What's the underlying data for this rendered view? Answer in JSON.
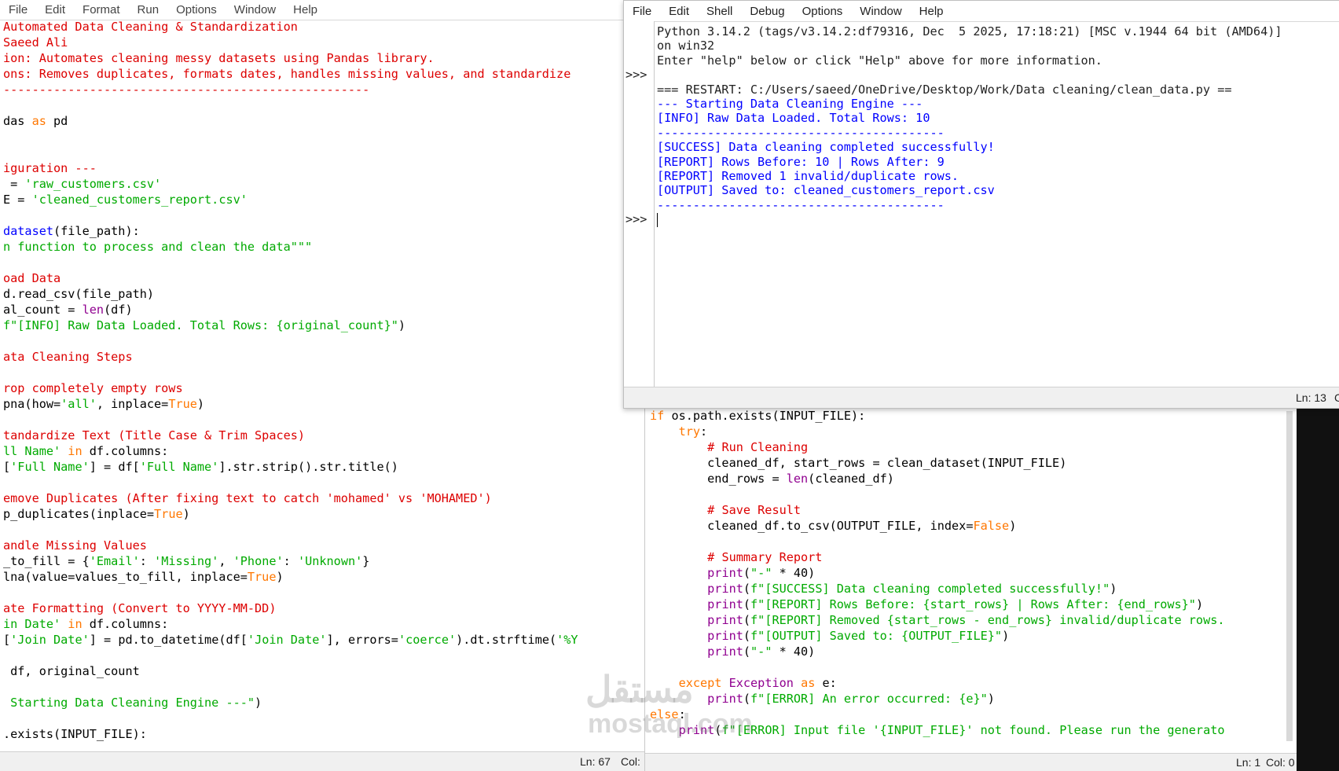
{
  "left_editor": {
    "menu": [
      "File",
      "Edit",
      "Format",
      "Run",
      "Options",
      "Window",
      "Help"
    ],
    "status": {
      "ln": "Ln: 67",
      "col": "Col:"
    },
    "lines": [
      [
        {
          "t": "Automated Data Cleaning & Standardization",
          "c": "c"
        }
      ],
      [
        {
          "t": "Saeed Ali",
          "c": "c"
        }
      ],
      [
        {
          "t": "ion: Automates cleaning messy datasets using Pandas library.",
          "c": "c"
        }
      ],
      [
        {
          "t": "ons: Removes duplicates, formats dates, handles missing values, and standardize",
          "c": "c"
        }
      ],
      [
        {
          "t": "---------------------------------------------------",
          "c": "c"
        }
      ],
      [],
      [
        {
          "t": "das ",
          "c": "n"
        },
        {
          "t": "as",
          "c": "k"
        },
        {
          "t": " pd",
          "c": "n"
        }
      ],
      [],
      [],
      [
        {
          "t": "iguration ---",
          "c": "c"
        }
      ],
      [
        {
          "t": " = ",
          "c": "n"
        },
        {
          "t": "'raw_customers.csv'",
          "c": "s"
        }
      ],
      [
        {
          "t": "E = ",
          "c": "n"
        },
        {
          "t": "'cleaned_customers_report.csv'",
          "c": "s"
        }
      ],
      [],
      [
        {
          "t": "dataset",
          "c": "d"
        },
        {
          "t": "(file_path):",
          "c": "n"
        }
      ],
      [
        {
          "t": "n function to process and clean the data\"\"\"",
          "c": "s"
        }
      ],
      [],
      [
        {
          "t": "oad Data",
          "c": "c"
        }
      ],
      [
        {
          "t": "d.read_csv(file_path)",
          "c": "n"
        }
      ],
      [
        {
          "t": "al_count = ",
          "c": "n"
        },
        {
          "t": "len",
          "c": "b"
        },
        {
          "t": "(df)",
          "c": "n"
        }
      ],
      [
        {
          "t": "f\"[INFO] Raw Data Loaded. Total Rows: {original_count}\"",
          "c": "s"
        },
        {
          "t": ")",
          "c": "n"
        }
      ],
      [],
      [
        {
          "t": "ata Cleaning Steps",
          "c": "c"
        }
      ],
      [],
      [
        {
          "t": "rop completely empty rows",
          "c": "c"
        }
      ],
      [
        {
          "t": "pna(how=",
          "c": "n"
        },
        {
          "t": "'all'",
          "c": "s"
        },
        {
          "t": ", inplace=",
          "c": "n"
        },
        {
          "t": "True",
          "c": "k"
        },
        {
          "t": ")",
          "c": "n"
        }
      ],
      [],
      [
        {
          "t": "tandardize Text (Title Case & Trim Spaces)",
          "c": "c"
        }
      ],
      [
        {
          "t": "ll Name'",
          "c": "s"
        },
        {
          "t": " in",
          "c": "k"
        },
        {
          "t": " df.columns:",
          "c": "n"
        }
      ],
      [
        {
          "t": "[",
          "c": "n"
        },
        {
          "t": "'Full Name'",
          "c": "s"
        },
        {
          "t": "] = df[",
          "c": "n"
        },
        {
          "t": "'Full Name'",
          "c": "s"
        },
        {
          "t": "].str.strip().str.title()",
          "c": "n"
        }
      ],
      [],
      [
        {
          "t": "emove Duplicates (After fixing text to catch 'mohamed' vs 'MOHAMED')",
          "c": "c"
        }
      ],
      [
        {
          "t": "p_duplicates(inplace=",
          "c": "n"
        },
        {
          "t": "True",
          "c": "k"
        },
        {
          "t": ")",
          "c": "n"
        }
      ],
      [],
      [
        {
          "t": "andle Missing Values",
          "c": "c"
        }
      ],
      [
        {
          "t": "_to_fill = {",
          "c": "n"
        },
        {
          "t": "'Email'",
          "c": "s"
        },
        {
          "t": ": ",
          "c": "n"
        },
        {
          "t": "'Missing'",
          "c": "s"
        },
        {
          "t": ", ",
          "c": "n"
        },
        {
          "t": "'Phone'",
          "c": "s"
        },
        {
          "t": ": ",
          "c": "n"
        },
        {
          "t": "'Unknown'",
          "c": "s"
        },
        {
          "t": "}",
          "c": "n"
        }
      ],
      [
        {
          "t": "lna(value=values_to_fill, inplace=",
          "c": "n"
        },
        {
          "t": "True",
          "c": "k"
        },
        {
          "t": ")",
          "c": "n"
        }
      ],
      [],
      [
        {
          "t": "ate Formatting (Convert to YYYY-MM-DD)",
          "c": "c"
        }
      ],
      [
        {
          "t": "in Date'",
          "c": "s"
        },
        {
          "t": " in",
          "c": "k"
        },
        {
          "t": " df.columns:",
          "c": "n"
        }
      ],
      [
        {
          "t": "[",
          "c": "n"
        },
        {
          "t": "'Join Date'",
          "c": "s"
        },
        {
          "t": "] = pd.to_datetime(df[",
          "c": "n"
        },
        {
          "t": "'Join Date'",
          "c": "s"
        },
        {
          "t": "], errors=",
          "c": "n"
        },
        {
          "t": "'coerce'",
          "c": "s"
        },
        {
          "t": ").dt.strftime(",
          "c": "n"
        },
        {
          "t": "'%Y",
          "c": "s"
        }
      ],
      [],
      [
        {
          "t": " df, original_count",
          "c": "n"
        }
      ],
      [],
      [
        {
          "t": " Starting Data Cleaning Engine ---\"",
          "c": "s"
        },
        {
          "t": ")",
          "c": "n"
        }
      ],
      [],
      [
        {
          "t": ".exists(INPUT_FILE):",
          "c": "n"
        }
      ]
    ]
  },
  "shell": {
    "menu": [
      "File",
      "Edit",
      "Shell",
      "Debug",
      "Options",
      "Window",
      "Help"
    ],
    "status": {
      "ln": "Ln: 13",
      "col": "C"
    },
    "lines": [
      {
        "p": "",
        "t": "Python 3.14.2 (tags/v3.14.2:df79316, Dec  5 2025, 17:18:21) [MSC v.1944 64 bit (AMD64)]",
        "c": "out"
      },
      {
        "p": "",
        "t": "on win32",
        "c": "out"
      },
      {
        "p": "",
        "t": "Enter \"help\" below or click \"Help\" above for more information.",
        "c": "out"
      },
      {
        "p": ">>>",
        "t": "",
        "c": "out"
      },
      {
        "p": "",
        "t": "=== RESTART: C:/Users/saeed/OneDrive/Desktop/Work/Data cleaning/clean_data.py ==",
        "c": "out"
      },
      {
        "p": "",
        "t": "--- Starting Data Cleaning Engine ---",
        "c": "blue"
      },
      {
        "p": "",
        "t": "[INFO] Raw Data Loaded. Total Rows: 10",
        "c": "blue"
      },
      {
        "p": "",
        "t": "----------------------------------------",
        "c": "blue"
      },
      {
        "p": "",
        "t": "[SUCCESS] Data cleaning completed successfully!",
        "c": "blue"
      },
      {
        "p": "",
        "t": "[REPORT] Rows Before: 10 | Rows After: 9",
        "c": "blue"
      },
      {
        "p": "",
        "t": "[REPORT] Removed 1 invalid/duplicate rows.",
        "c": "blue"
      },
      {
        "p": "",
        "t": "[OUTPUT] Saved to: cleaned_customers_report.csv",
        "c": "blue"
      },
      {
        "p": "",
        "t": "----------------------------------------",
        "c": "blue"
      },
      {
        "p": ">>>",
        "t": "",
        "c": "out",
        "cursor": true
      }
    ]
  },
  "right_editor": {
    "status": {
      "ln": "Ln: 1",
      "col": "Col: 0"
    },
    "lines": [
      [
        {
          "t": "if",
          "c": "k"
        },
        {
          "t": " os.path.exists(INPUT_FILE):",
          "c": "n"
        }
      ],
      [
        {
          "t": "    ",
          "c": "n"
        },
        {
          "t": "try",
          "c": "k"
        },
        {
          "t": ":",
          "c": "n"
        }
      ],
      [
        {
          "t": "        ",
          "c": "n"
        },
        {
          "t": "# Run Cleaning",
          "c": "c"
        }
      ],
      [
        {
          "t": "        cleaned_df, start_rows = clean_dataset(INPUT_FILE)",
          "c": "n"
        }
      ],
      [
        {
          "t": "        end_rows = ",
          "c": "n"
        },
        {
          "t": "len",
          "c": "b"
        },
        {
          "t": "(cleaned_df)",
          "c": "n"
        }
      ],
      [],
      [
        {
          "t": "        ",
          "c": "n"
        },
        {
          "t": "# Save Result",
          "c": "c"
        }
      ],
      [
        {
          "t": "        cleaned_df.to_csv(OUTPUT_FILE, index=",
          "c": "n"
        },
        {
          "t": "False",
          "c": "k"
        },
        {
          "t": ")",
          "c": "n"
        }
      ],
      [],
      [
        {
          "t": "        ",
          "c": "n"
        },
        {
          "t": "# Summary Report",
          "c": "c"
        }
      ],
      [
        {
          "t": "        ",
          "c": "n"
        },
        {
          "t": "print",
          "c": "b"
        },
        {
          "t": "(",
          "c": "n"
        },
        {
          "t": "\"-\"",
          "c": "s"
        },
        {
          "t": " * 40)",
          "c": "n"
        }
      ],
      [
        {
          "t": "        ",
          "c": "n"
        },
        {
          "t": "print",
          "c": "b"
        },
        {
          "t": "(",
          "c": "n"
        },
        {
          "t": "f\"[SUCCESS] Data cleaning completed successfully!\"",
          "c": "s"
        },
        {
          "t": ")",
          "c": "n"
        }
      ],
      [
        {
          "t": "        ",
          "c": "n"
        },
        {
          "t": "print",
          "c": "b"
        },
        {
          "t": "(",
          "c": "n"
        },
        {
          "t": "f\"[REPORT] Rows Before: {start_rows} | Rows After: {end_rows}\"",
          "c": "s"
        },
        {
          "t": ")",
          "c": "n"
        }
      ],
      [
        {
          "t": "        ",
          "c": "n"
        },
        {
          "t": "print",
          "c": "b"
        },
        {
          "t": "(",
          "c": "n"
        },
        {
          "t": "f\"[REPORT] Removed {start_rows - end_rows} invalid/duplicate rows.",
          "c": "s"
        }
      ],
      [
        {
          "t": "        ",
          "c": "n"
        },
        {
          "t": "print",
          "c": "b"
        },
        {
          "t": "(",
          "c": "n"
        },
        {
          "t": "f\"[OUTPUT] Saved to: {OUTPUT_FILE}\"",
          "c": "s"
        },
        {
          "t": ")",
          "c": "n"
        }
      ],
      [
        {
          "t": "        ",
          "c": "n"
        },
        {
          "t": "print",
          "c": "b"
        },
        {
          "t": "(",
          "c": "n"
        },
        {
          "t": "\"-\"",
          "c": "s"
        },
        {
          "t": " * 40)",
          "c": "n"
        }
      ],
      [],
      [
        {
          "t": "    ",
          "c": "n"
        },
        {
          "t": "except",
          "c": "k"
        },
        {
          "t": " ",
          "c": "n"
        },
        {
          "t": "Exception",
          "c": "b"
        },
        {
          "t": " ",
          "c": "n"
        },
        {
          "t": "as",
          "c": "k"
        },
        {
          "t": " e:",
          "c": "n"
        }
      ],
      [
        {
          "t": "        ",
          "c": "n"
        },
        {
          "t": "print",
          "c": "b"
        },
        {
          "t": "(",
          "c": "n"
        },
        {
          "t": "f\"[ERROR] An error occurred: {e}\"",
          "c": "s"
        },
        {
          "t": ")",
          "c": "n"
        }
      ],
      [
        {
          "t": "else",
          "c": "k"
        },
        {
          "t": ":",
          "c": "n"
        }
      ],
      [
        {
          "t": "    ",
          "c": "n"
        },
        {
          "t": "print",
          "c": "b"
        },
        {
          "t": "(",
          "c": "n"
        },
        {
          "t": "f\"[ERROR] Input file '{INPUT_FILE}' not found. Please run the generato",
          "c": "s"
        }
      ]
    ]
  },
  "watermark": {
    "ar": "مستقل",
    "en": "mostaql.com"
  },
  "colors": {
    "comment": "#dd0000",
    "string": "#00aa00",
    "keyword": "#ff7700",
    "builtin": "#900090",
    "def": "#0000ff",
    "shell_output": "#0000ff"
  }
}
